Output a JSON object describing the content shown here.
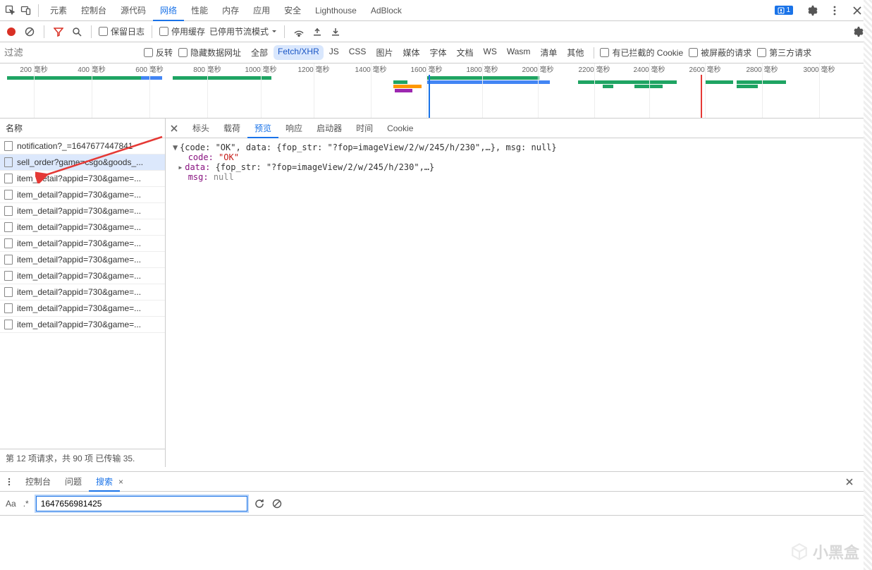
{
  "topTabs": {
    "items": [
      {
        "label": "元素"
      },
      {
        "label": "控制台"
      },
      {
        "label": "源代码"
      },
      {
        "label": "网络",
        "active": true
      },
      {
        "label": "性能"
      },
      {
        "label": "内存"
      },
      {
        "label": "应用"
      },
      {
        "label": "安全"
      },
      {
        "label": "Lighthouse"
      },
      {
        "label": "AdBlock"
      }
    ],
    "issuesBadge": "1"
  },
  "toolbar": {
    "preserveLog": "保留日志",
    "disableCache": "停用缓存",
    "throttling": "已停用节流模式"
  },
  "filterRow": {
    "placeholder": "过滤",
    "invert": "反转",
    "hideDataUrls": "隐藏数据网址",
    "types": [
      {
        "label": "全部"
      },
      {
        "label": "Fetch/XHR",
        "active": true
      },
      {
        "label": "JS"
      },
      {
        "label": "CSS"
      },
      {
        "label": "图片"
      },
      {
        "label": "媒体"
      },
      {
        "label": "字体"
      },
      {
        "label": "文档"
      },
      {
        "label": "WS"
      },
      {
        "label": "Wasm"
      },
      {
        "label": "清单"
      },
      {
        "label": "其他"
      }
    ],
    "blockedCookies": "有已拦截的 Cookie",
    "blockedRequests": "被屏蔽的请求",
    "thirdParty": "第三方请求"
  },
  "timeline": {
    "ticks": [
      "200 毫秒",
      "400 毫秒",
      "600 毫秒",
      "800 毫秒",
      "1000 毫秒",
      "1200 毫秒",
      "1400 毫秒",
      "1600 毫秒",
      "1800 毫秒",
      "2000 毫秒",
      "2200 毫秒",
      "2400 毫秒",
      "2600 毫秒",
      "2800 毫秒",
      "3000 毫秒"
    ]
  },
  "requests": {
    "header": "名称",
    "items": [
      {
        "name": "notification?_=1647677447841"
      },
      {
        "name": "sell_order?game=csgo&goods_...",
        "selected": true
      },
      {
        "name": "item_detail?appid=730&game=..."
      },
      {
        "name": "item_detail?appid=730&game=..."
      },
      {
        "name": "item_detail?appid=730&game=..."
      },
      {
        "name": "item_detail?appid=730&game=..."
      },
      {
        "name": "item_detail?appid=730&game=..."
      },
      {
        "name": "item_detail?appid=730&game=..."
      },
      {
        "name": "item_detail?appid=730&game=..."
      },
      {
        "name": "item_detail?appid=730&game=..."
      },
      {
        "name": "item_detail?appid=730&game=..."
      },
      {
        "name": "item_detail?appid=730&game=..."
      }
    ],
    "status": "第 12 项请求，共 90 项    已传输 35."
  },
  "detailTabs": [
    {
      "label": "标头"
    },
    {
      "label": "载荷"
    },
    {
      "label": "预览",
      "active": true
    },
    {
      "label": "响应"
    },
    {
      "label": "启动器"
    },
    {
      "label": "时间"
    },
    {
      "label": "Cookie"
    }
  ],
  "preview": {
    "summary": "{code: \"OK\", data: {fop_str: \"?fop=imageView/2/w/245/h/230\",…}, msg: null}",
    "codeKey": "code:",
    "codeVal": " \"OK\"",
    "dataKey": "data:",
    "dataVal": " {fop_str: \"?fop=imageView/2/w/245/h/230\",…}",
    "msgKey": "msg:",
    "msgVal": " null"
  },
  "drawer": {
    "tabs": [
      {
        "label": "控制台"
      },
      {
        "label": "问题"
      },
      {
        "label": "搜索",
        "active": true,
        "closable": true
      }
    ],
    "search": {
      "aa": "Aa",
      "regex": ".*",
      "value": "1647656981425"
    }
  },
  "watermark": "小黑盒"
}
